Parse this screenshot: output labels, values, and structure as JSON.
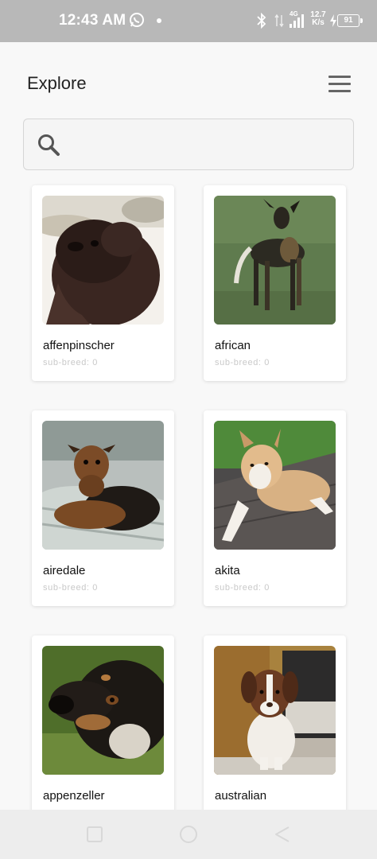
{
  "status_bar": {
    "time": "12:43 AM",
    "network": "4G",
    "speed_value": "12.7",
    "speed_unit": "K/s",
    "battery": "91",
    "icons": [
      "whatsapp-icon",
      "notification-dot",
      "bluetooth-icon",
      "data-arrows-icon",
      "signal-icon",
      "charging-icon",
      "battery-icon"
    ]
  },
  "header": {
    "title": "Explore",
    "menu_icon": "hamburger-menu-icon"
  },
  "search": {
    "icon": "search-icon",
    "value": "",
    "placeholder": ""
  },
  "breeds": [
    {
      "name": "affenpinscher",
      "sub_breed": "sub-breed: 0"
    },
    {
      "name": "african",
      "sub_breed": "sub-breed: 0"
    },
    {
      "name": "airedale",
      "sub_breed": "sub-breed: 0"
    },
    {
      "name": "akita",
      "sub_breed": "sub-breed: 0"
    },
    {
      "name": "appenzeller",
      "sub_breed": ""
    },
    {
      "name": "australian",
      "sub_breed": ""
    }
  ],
  "nav_bar": {
    "buttons": [
      "recent-apps-icon",
      "home-icon",
      "back-icon"
    ]
  },
  "colors": {
    "status_bar": "#b8b8b8",
    "background": "#f8f8f8",
    "card": "#ffffff",
    "subtext": "#c9c9c9",
    "nav_bar": "#ededed"
  }
}
